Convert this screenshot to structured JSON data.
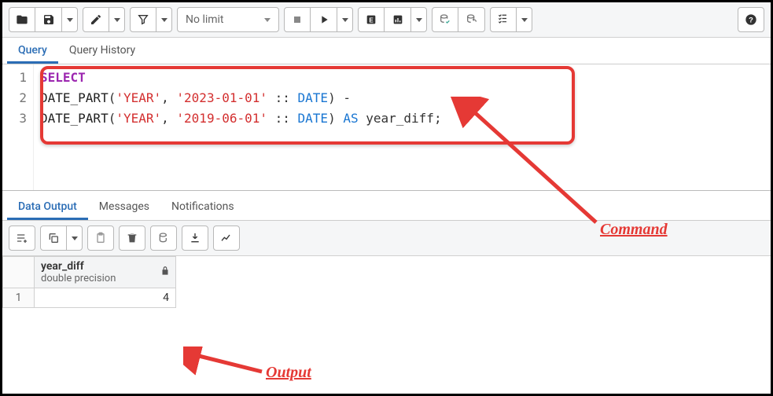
{
  "toolbar": {
    "limit_label": "No limit"
  },
  "tabs": {
    "query": "Query",
    "history": "Query History"
  },
  "editor": {
    "lines": [
      "1",
      "2",
      "3"
    ],
    "code": {
      "l1": {
        "select": "SELECT"
      },
      "l2": {
        "fn": "DATE_PART",
        "open": "(",
        "str1": "'YEAR'",
        "comma": ", ",
        "str2": "'2023-01-01'",
        "cast": " :: ",
        "type": "DATE",
        "close": ")",
        "minus": " -"
      },
      "l3": {
        "fn": "DATE_PART",
        "open": "(",
        "str1": "'YEAR'",
        "comma": ", ",
        "str2": "'2019-06-01'",
        "cast": " :: ",
        "type": "DATE",
        "close": ")",
        "as": " AS ",
        "ident": "year_diff",
        "semi": ";"
      }
    }
  },
  "output_tabs": {
    "data": "Data Output",
    "messages": "Messages",
    "notifications": "Notifications"
  },
  "result": {
    "col_name": "year_diff",
    "col_type": "double precision",
    "row_num": "1",
    "value": "4"
  },
  "annotations": {
    "command": "Command",
    "output": "Output"
  }
}
